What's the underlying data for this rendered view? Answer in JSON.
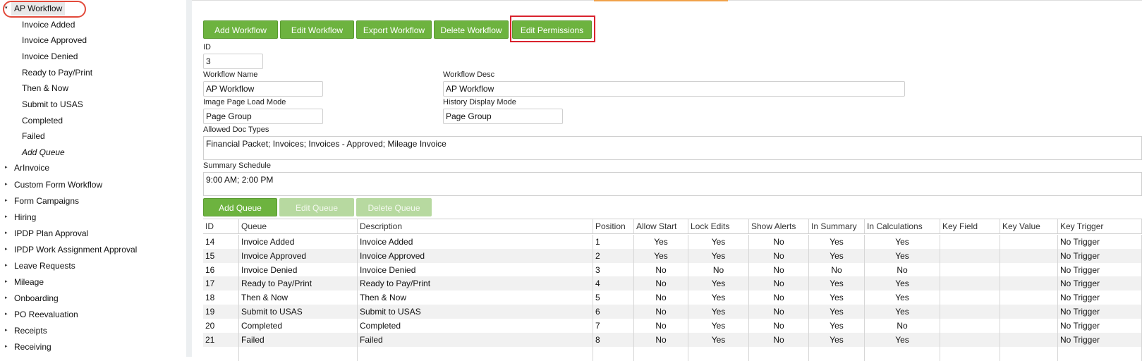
{
  "sidebar": {
    "items": [
      {
        "label": "AP Workflow",
        "expanded": true,
        "selected": true
      },
      {
        "label": "Invoice Added",
        "child": true
      },
      {
        "label": "Invoice Approved",
        "child": true
      },
      {
        "label": "Invoice Denied",
        "child": true
      },
      {
        "label": "Ready to Pay/Print",
        "child": true
      },
      {
        "label": "Then & Now",
        "child": true
      },
      {
        "label": "Submit to USAS",
        "child": true
      },
      {
        "label": "Completed",
        "child": true
      },
      {
        "label": "Failed",
        "child": true
      },
      {
        "label": "Add Queue",
        "child": true,
        "italic": true
      },
      {
        "label": "ArInvoice"
      },
      {
        "label": "Custom Form Workflow"
      },
      {
        "label": "Form Campaigns"
      },
      {
        "label": "Hiring"
      },
      {
        "label": "IPDP Plan Approval"
      },
      {
        "label": "IPDP Work Assignment Approval"
      },
      {
        "label": "Leave Requests"
      },
      {
        "label": "Mileage"
      },
      {
        "label": "Onboarding"
      },
      {
        "label": "PO Reevaluation"
      },
      {
        "label": "Receipts"
      },
      {
        "label": "Receiving"
      }
    ]
  },
  "toolbar": {
    "add_workflow": "Add Workflow",
    "edit_workflow": "Edit Workflow",
    "export_workflow": "Export Workflow",
    "delete_workflow": "Delete Workflow",
    "edit_permissions": "Edit Permissions"
  },
  "form": {
    "id_label": "ID",
    "id_value": "3",
    "name_label": "Workflow Name",
    "name_value": "AP Workflow",
    "desc_label": "Workflow Desc",
    "desc_value": "AP Workflow",
    "image_mode_label": "Image Page Load Mode",
    "image_mode_value": "Page Group",
    "history_mode_label": "History Display Mode",
    "history_mode_value": "Page Group",
    "doc_types_label": "Allowed Doc Types",
    "doc_types_value": "Financial Packet; Invoices; Invoices - Approved; Mileage Invoice",
    "schedule_label": "Summary Schedule",
    "schedule_value": "9:00 AM; 2:00 PM"
  },
  "queue_toolbar": {
    "add_queue": "Add Queue",
    "edit_queue": "Edit Queue",
    "delete_queue": "Delete Queue"
  },
  "table": {
    "columns": [
      "ID",
      "Queue",
      "Description",
      "Position",
      "Allow Start",
      "Lock Edits",
      "Show Alerts",
      "In Summary",
      "In Calculations",
      "Key Field",
      "Key Value",
      "Key Trigger"
    ],
    "rows": [
      [
        "14",
        "Invoice Added",
        "Invoice Added",
        "1",
        "Yes",
        "Yes",
        "No",
        "Yes",
        "Yes",
        "",
        "",
        "No Trigger"
      ],
      [
        "15",
        "Invoice Approved",
        "Invoice Approved",
        "2",
        "Yes",
        "Yes",
        "No",
        "Yes",
        "Yes",
        "",
        "",
        "No Trigger"
      ],
      [
        "16",
        "Invoice Denied",
        "Invoice Denied",
        "3",
        "No",
        "No",
        "No",
        "No",
        "No",
        "",
        "",
        "No Trigger"
      ],
      [
        "17",
        "Ready to Pay/Print",
        "Ready to Pay/Print",
        "4",
        "No",
        "Yes",
        "No",
        "Yes",
        "Yes",
        "",
        "",
        "No Trigger"
      ],
      [
        "18",
        "Then & Now",
        "Then & Now",
        "5",
        "No",
        "Yes",
        "No",
        "Yes",
        "Yes",
        "",
        "",
        "No Trigger"
      ],
      [
        "19",
        "Submit to USAS",
        "Submit to USAS",
        "6",
        "No",
        "Yes",
        "No",
        "Yes",
        "Yes",
        "",
        "",
        "No Trigger"
      ],
      [
        "20",
        "Completed",
        "Completed",
        "7",
        "No",
        "Yes",
        "No",
        "Yes",
        "No",
        "",
        "",
        "No Trigger"
      ],
      [
        "21",
        "Failed",
        "Failed",
        "8",
        "No",
        "Yes",
        "No",
        "Yes",
        "Yes",
        "",
        "",
        "No Trigger"
      ]
    ]
  },
  "colors": {
    "button_green": "#6db33f",
    "highlight_red": "#d9232e",
    "accent_orange": "#f0a24a"
  }
}
